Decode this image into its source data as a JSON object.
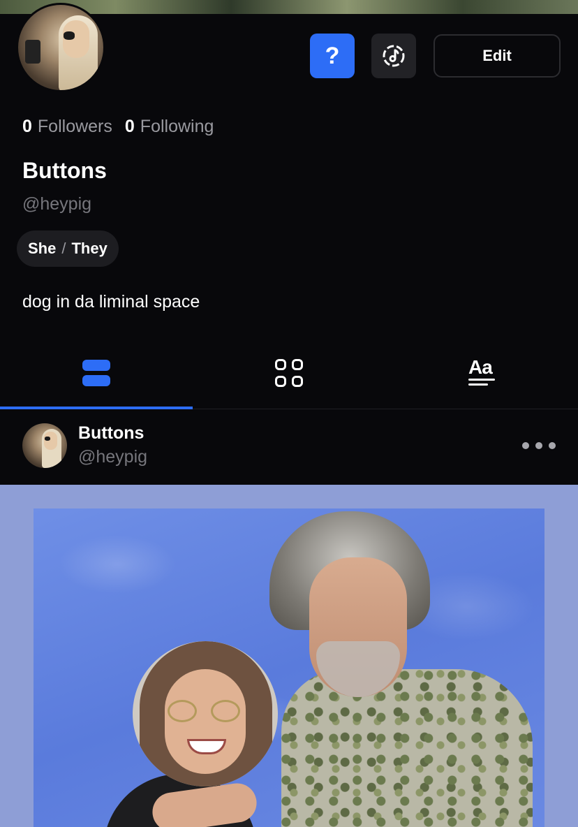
{
  "profile": {
    "followers_count": "0",
    "followers_label": "Followers",
    "following_count": "0",
    "following_label": "Following",
    "display_name": "Buttons",
    "handle": "@heypig",
    "pronoun_1": "She",
    "pronoun_sep": "/",
    "pronoun_2": "They",
    "bio": "dog in da liminal space"
  },
  "header": {
    "help_glyph": "?",
    "edit_label": "Edit"
  },
  "tabs": [
    {
      "icon": "posts-stack-icon",
      "active": true
    },
    {
      "icon": "grid-icon",
      "active": false
    },
    {
      "icon": "text-aa-icon",
      "label": "Aa",
      "active": false
    }
  ],
  "post": {
    "author_name": "Buttons",
    "author_handle": "@heypig"
  },
  "colors": {
    "accent": "#2d6df6",
    "background": "#08080b",
    "muted_text": "#76767c"
  }
}
